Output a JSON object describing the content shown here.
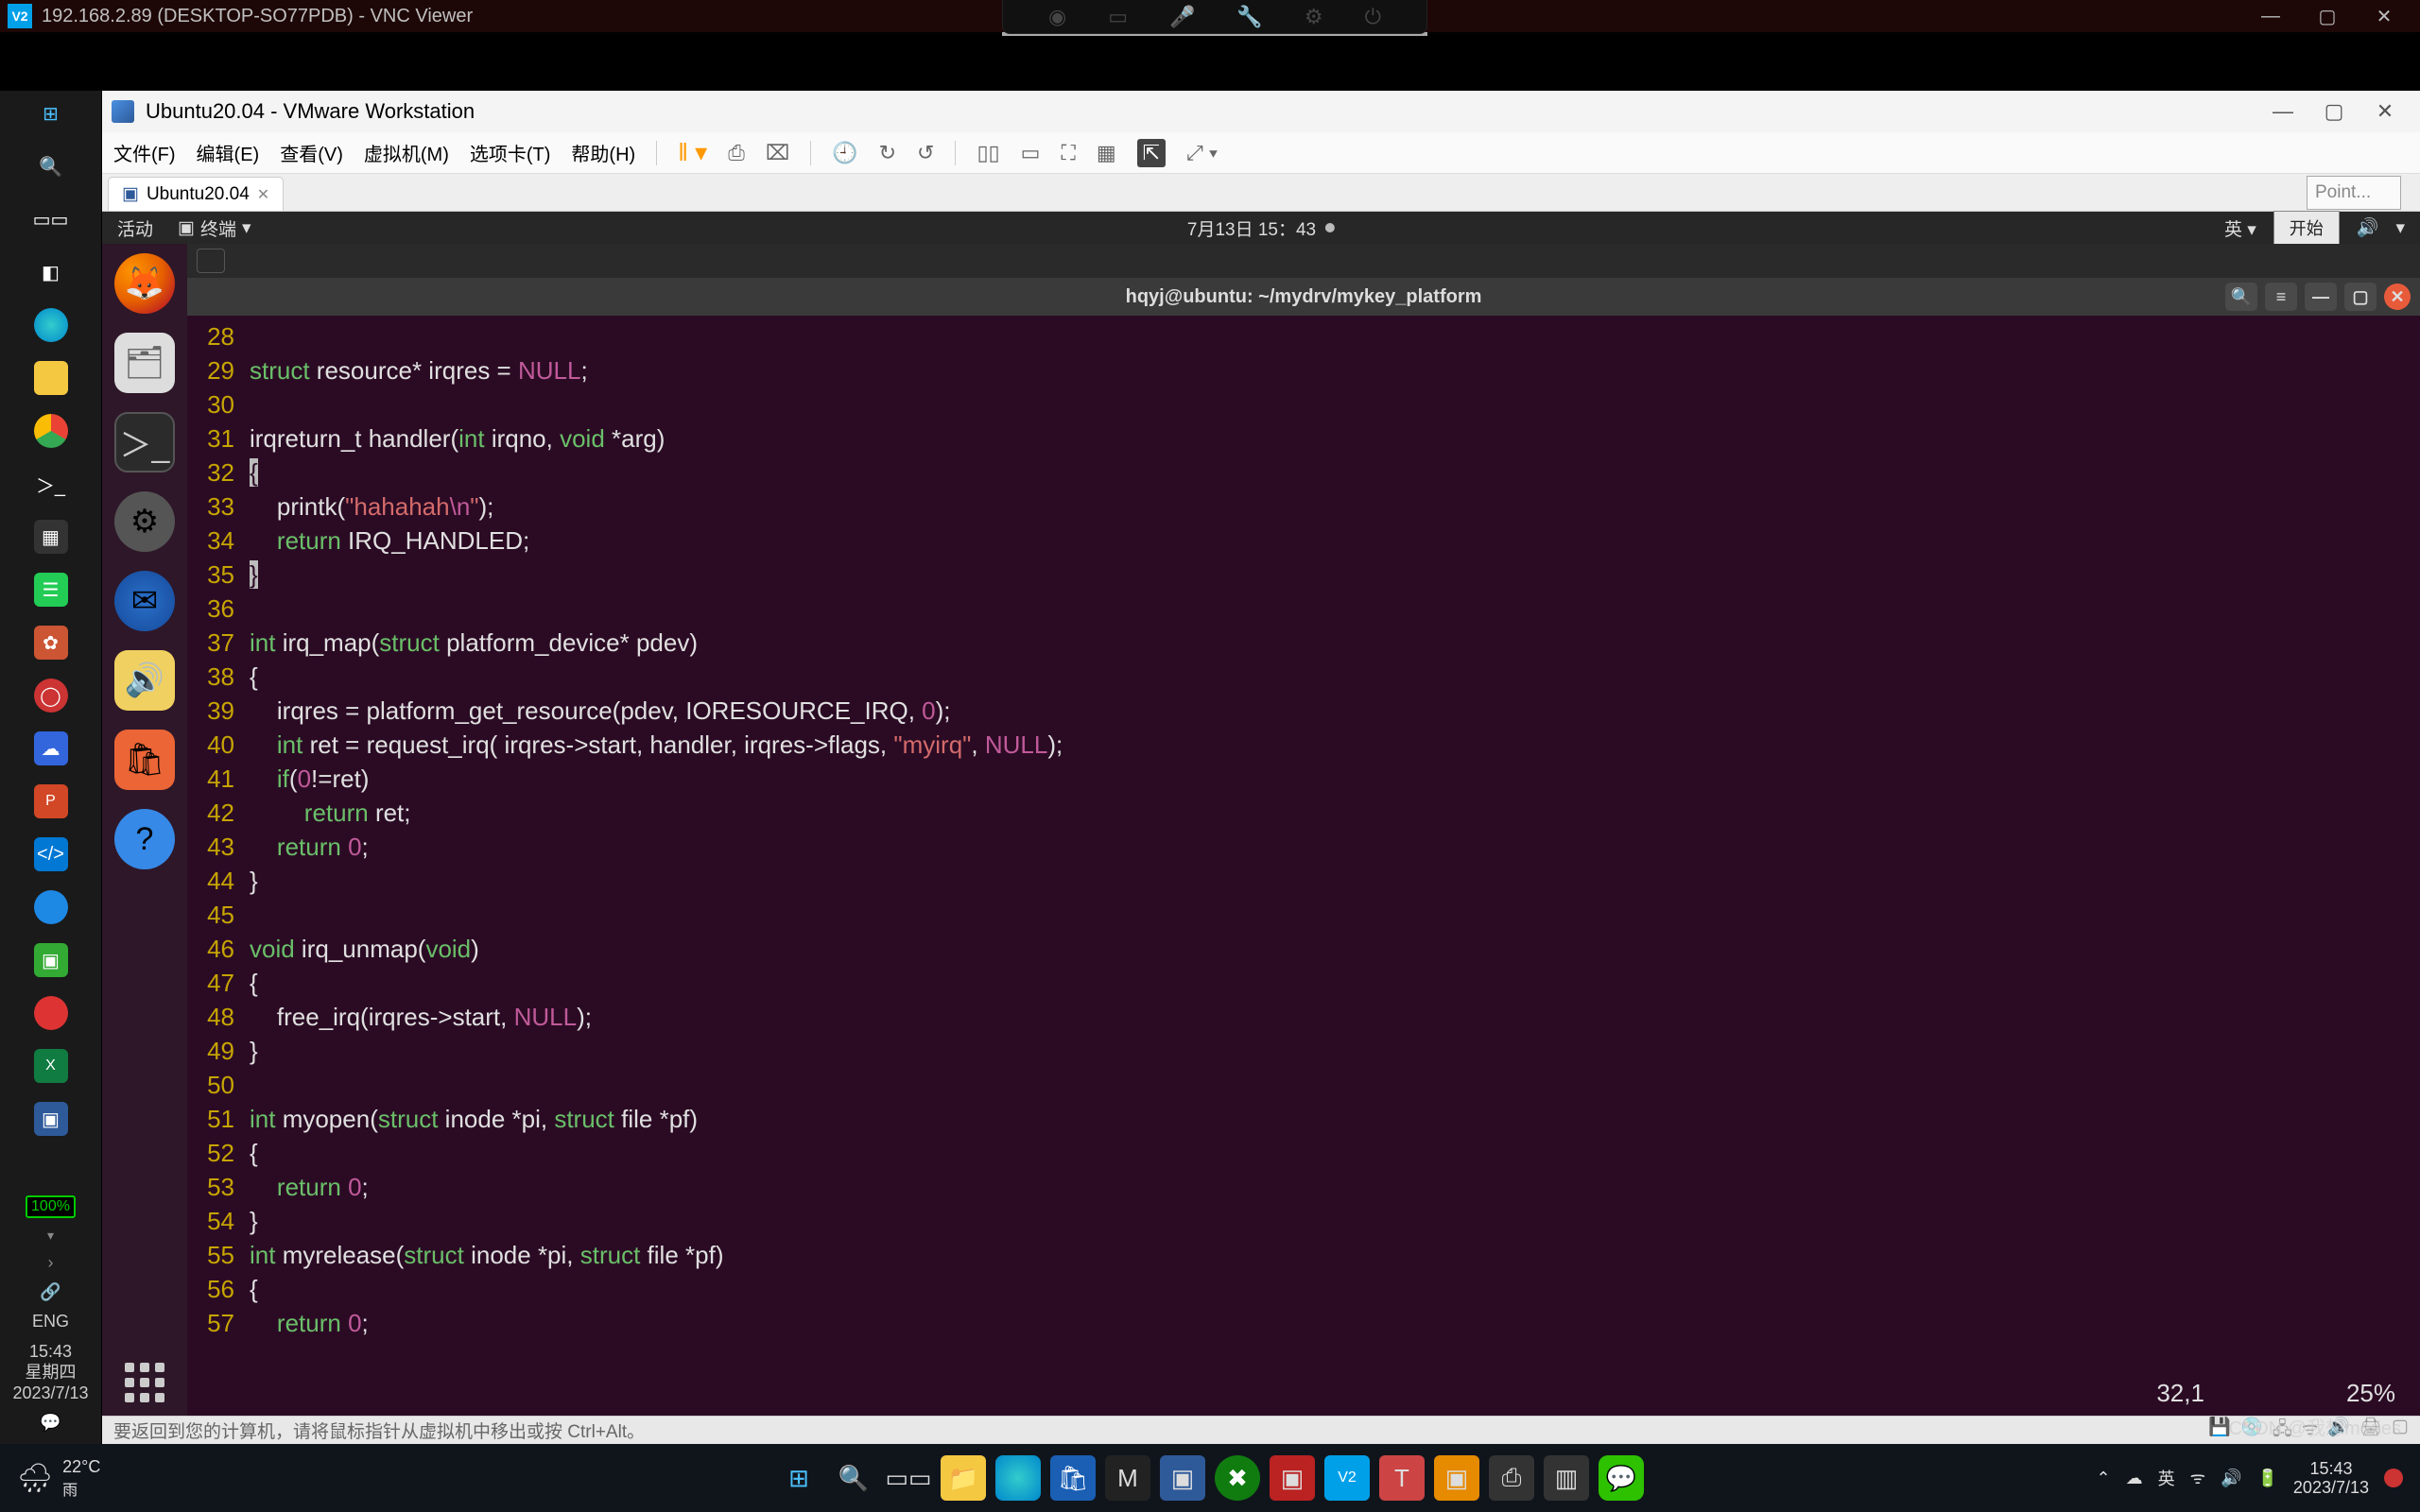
{
  "vnc": {
    "title": "192.168.2.89 (DESKTOP-SO77PDB) - VNC Viewer",
    "logo": "V2"
  },
  "vmware": {
    "title": "Ubuntu20.04 - VMware Workstation",
    "menu": [
      "文件(F)",
      "编辑(E)",
      "查看(V)",
      "虚拟机(M)",
      "选项卡(T)",
      "帮助(H)"
    ],
    "tab": "Ubuntu20.04",
    "point_placeholder": "Point...",
    "status_hint": "要返回到您的计算机，请将鼠标指针从虚拟机中移出或按 Ctrl+Alt。"
  },
  "ubuntu": {
    "activities": "活动",
    "terminal_label": "终端",
    "datetime": "7月13日 15：43",
    "lang": "英",
    "start_btn": "开始"
  },
  "terminal": {
    "title": "hqyj@ubuntu: ~/mydrv/mykey_platform",
    "cursor_pos": "32,1",
    "scroll_pct": "25%"
  },
  "code_lines": [
    {
      "n": 28,
      "t": []
    },
    {
      "n": 29,
      "t": [
        [
          "kw",
          "struct"
        ],
        [
          "op",
          " resource* irqres = "
        ],
        [
          "cst",
          "NULL"
        ],
        [
          "op",
          ";"
        ]
      ]
    },
    {
      "n": 30,
      "t": []
    },
    {
      "n": 31,
      "t": [
        [
          "op",
          "irqreturn_t handler("
        ],
        [
          "ty",
          "int"
        ],
        [
          "op",
          " irqno, "
        ],
        [
          "ty",
          "void"
        ],
        [
          "op",
          " *arg)"
        ]
      ]
    },
    {
      "n": 32,
      "t": [
        [
          "hlbr",
          "{"
        ]
      ]
    },
    {
      "n": 33,
      "t": [
        [
          "op",
          "    printk("
        ],
        [
          "str",
          "\"hahahah"
        ],
        [
          "cst",
          "\\n"
        ],
        [
          "str",
          "\""
        ],
        [
          "op",
          ");"
        ]
      ]
    },
    {
      "n": 34,
      "t": [
        [
          "op",
          "    "
        ],
        [
          "kw",
          "return"
        ],
        [
          "op",
          " IRQ_HANDLED;"
        ]
      ]
    },
    {
      "n": 35,
      "t": [
        [
          "hlbr",
          "}"
        ]
      ]
    },
    {
      "n": 36,
      "t": []
    },
    {
      "n": 37,
      "t": [
        [
          "ty",
          "int"
        ],
        [
          "op",
          " irq_map("
        ],
        [
          "kw",
          "struct"
        ],
        [
          "op",
          " platform_device* pdev)"
        ]
      ]
    },
    {
      "n": 38,
      "t": [
        [
          "op",
          "{"
        ]
      ]
    },
    {
      "n": 39,
      "t": [
        [
          "op",
          "    irqres = platform_get_resource(pdev, IORESOURCE_IRQ, "
        ],
        [
          "num",
          "0"
        ],
        [
          "op",
          ");"
        ]
      ]
    },
    {
      "n": 40,
      "t": [
        [
          "op",
          "    "
        ],
        [
          "ty",
          "int"
        ],
        [
          "op",
          " ret = request_irq( irqres->start, handler, irqres->flags, "
        ],
        [
          "str",
          "\"myirq\""
        ],
        [
          "op",
          ", "
        ],
        [
          "cst",
          "NULL"
        ],
        [
          "op",
          ");"
        ]
      ]
    },
    {
      "n": 41,
      "t": [
        [
          "op",
          "    "
        ],
        [
          "kw",
          "if"
        ],
        [
          "op",
          "("
        ],
        [
          "num",
          "0"
        ],
        [
          "op",
          "!=ret)"
        ]
      ]
    },
    {
      "n": 42,
      "t": [
        [
          "op",
          "        "
        ],
        [
          "kw",
          "return"
        ],
        [
          "op",
          " ret;"
        ]
      ]
    },
    {
      "n": 43,
      "t": [
        [
          "op",
          "    "
        ],
        [
          "kw",
          "return"
        ],
        [
          "op",
          " "
        ],
        [
          "num",
          "0"
        ],
        [
          "op",
          ";"
        ]
      ]
    },
    {
      "n": 44,
      "t": [
        [
          "op",
          "}"
        ]
      ]
    },
    {
      "n": 45,
      "t": []
    },
    {
      "n": 46,
      "t": [
        [
          "ty",
          "void"
        ],
        [
          "op",
          " irq_unmap("
        ],
        [
          "ty",
          "void"
        ],
        [
          "op",
          ")"
        ]
      ]
    },
    {
      "n": 47,
      "t": [
        [
          "op",
          "{"
        ]
      ]
    },
    {
      "n": 48,
      "t": [
        [
          "op",
          "    free_irq(irqres->start, "
        ],
        [
          "cst",
          "NULL"
        ],
        [
          "op",
          ");"
        ]
      ]
    },
    {
      "n": 49,
      "t": [
        [
          "op",
          "}"
        ]
      ]
    },
    {
      "n": 50,
      "t": []
    },
    {
      "n": 51,
      "t": [
        [
          "ty",
          "int"
        ],
        [
          "op",
          " myopen("
        ],
        [
          "kw",
          "struct"
        ],
        [
          "op",
          " inode *pi, "
        ],
        [
          "kw",
          "struct"
        ],
        [
          "op",
          " file *pf)"
        ]
      ]
    },
    {
      "n": 52,
      "t": [
        [
          "op",
          "{"
        ]
      ]
    },
    {
      "n": 53,
      "t": [
        [
          "op",
          "    "
        ],
        [
          "kw",
          "return"
        ],
        [
          "op",
          " "
        ],
        [
          "num",
          "0"
        ],
        [
          "op",
          ";"
        ]
      ]
    },
    {
      "n": 54,
      "t": [
        [
          "op",
          "}"
        ]
      ]
    },
    {
      "n": 55,
      "t": [
        [
          "ty",
          "int"
        ],
        [
          "op",
          " myrelease("
        ],
        [
          "kw",
          "struct"
        ],
        [
          "op",
          " inode *pi, "
        ],
        [
          "kw",
          "struct"
        ],
        [
          "op",
          " file *pf)"
        ]
      ]
    },
    {
      "n": 56,
      "t": [
        [
          "op",
          "{"
        ]
      ]
    },
    {
      "n": 57,
      "t": [
        [
          "op",
          "    "
        ],
        [
          "kw",
          "return"
        ],
        [
          "op",
          " "
        ],
        [
          "num",
          "0"
        ],
        [
          "op",
          ";"
        ]
      ]
    }
  ],
  "win_left": {
    "battery": "100%",
    "lang": "ENG",
    "time": "15:43",
    "weekday": "星期四",
    "date": "2023/7/13"
  },
  "win_bottom": {
    "temp": "22°C",
    "cond": "雨",
    "lang": "英",
    "time": "15:43",
    "date": "2023/7/13",
    "watermark_left": "CSDN",
    "watermark_right": "@我想mories"
  }
}
